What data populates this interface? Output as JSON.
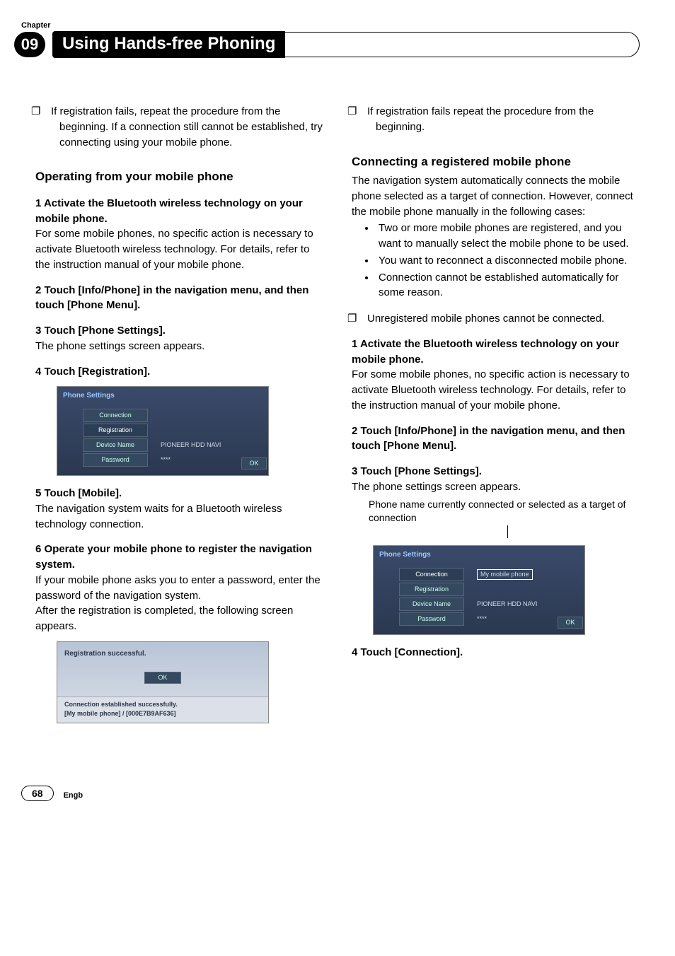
{
  "chapterLabel": "Chapter",
  "chapterNum": "09",
  "title": "Using Hands-free Phoning",
  "left": {
    "bullet1": "If registration fails, repeat the procedure from the beginning. If a connection still cannot be established, try connecting using your mobile phone.",
    "h3": "Operating from your mobile phone",
    "s1_label": "1   Activate the Bluetooth wireless technology on your mobile phone.",
    "s1_body": "For some mobile phones, no specific action is necessary to activate Bluetooth wireless technology. For details, refer to the instruction manual of your mobile phone.",
    "s2_label": "2   Touch [Info/Phone] in the navigation menu, and then touch [Phone Menu].",
    "s3_label": "3   Touch [Phone Settings].",
    "s3_body": "The phone settings screen appears.",
    "s4_label": "4   Touch [Registration].",
    "shot1": {
      "title": "Phone Settings",
      "r1": "Connection",
      "r2": "Registration",
      "r3": "Device Name",
      "r3v": "PIONEER HDD NAVI",
      "r4": "Password",
      "r4v": "****",
      "ok": "OK"
    },
    "s5_label": "5   Touch [Mobile].",
    "s5_body": "The navigation system waits for a Bluetooth wireless technology connection.",
    "s6_label": "6   Operate your mobile phone to register the navigation system.",
    "s6_body1": "If your mobile phone asks you to enter a password, enter the password of the navigation system.",
    "s6_body2": "After the registration is completed, the following screen appears.",
    "shot2": {
      "msg": "Registration successful.",
      "ok": "OK",
      "line1": "Connection established successfully.",
      "line2": "[My mobile phone] / [000E7B9AF636]"
    }
  },
  "right": {
    "bullet1": "If registration fails repeat the procedure from the beginning.",
    "h3": "Connecting a registered mobile phone",
    "intro": "The navigation system automatically connects the mobile phone selected as a target of connection. However, connect the mobile phone manually in the following cases:",
    "li1": "Two or more mobile phones are registered, and you want to manually select the mobile phone to be used.",
    "li2": "You want to reconnect a disconnected mobile phone.",
    "li3": "Connection cannot be established automatically for some reason.",
    "sq": "Unregistered mobile phones cannot be connected.",
    "s1_label": "1   Activate the Bluetooth wireless technology on your mobile phone.",
    "s1_body": "For some mobile phones, no specific action is necessary to activate Bluetooth wireless technology. For details, refer to the instruction manual of your mobile phone.",
    "s2_label": "2   Touch [Info/Phone] in the navigation menu, and then touch [Phone Menu].",
    "s3_label": "3   Touch [Phone Settings].",
    "s3_body": "The phone settings screen appears.",
    "caption": "Phone name currently connected or selected as a target of connection",
    "shot": {
      "title": "Phone Settings",
      "r1": "Connection",
      "r1v": "My mobile phone",
      "r2": "Registration",
      "r3": "Device Name",
      "r3v": "PIONEER HDD NAVI",
      "r4": "Password",
      "r4v": "****",
      "ok": "OK"
    },
    "s4_label": "4   Touch [Connection]."
  },
  "pageNum": "68",
  "engb": "Engb"
}
